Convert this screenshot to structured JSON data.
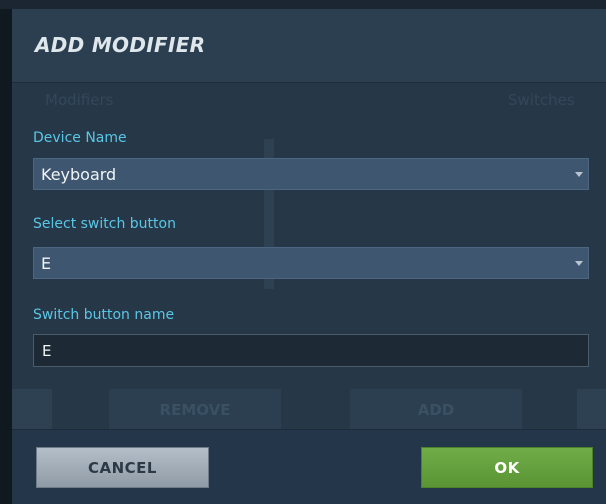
{
  "background_window": {
    "title_fragment": "",
    "column_left": "Modifiers",
    "column_right": "Switches",
    "remove_label": "REMOVE",
    "add_label": "ADD"
  },
  "dialog": {
    "title": "ADD MODIFIER",
    "device_name": {
      "label": "Device Name",
      "value": "Keyboard",
      "icon": "chevron-down-icon"
    },
    "switch_button": {
      "label": "Select switch button",
      "value": "E",
      "icon": "chevron-down-icon"
    },
    "switch_button_name": {
      "label": "Switch button name",
      "value": "E"
    },
    "cancel_label": "CANCEL",
    "ok_label": "OK"
  },
  "colors": {
    "accent_label": "#5ac6e6",
    "ok_button": "#63a03c",
    "cancel_button": "#a3aeb8",
    "dialog_bg": "#263848"
  }
}
